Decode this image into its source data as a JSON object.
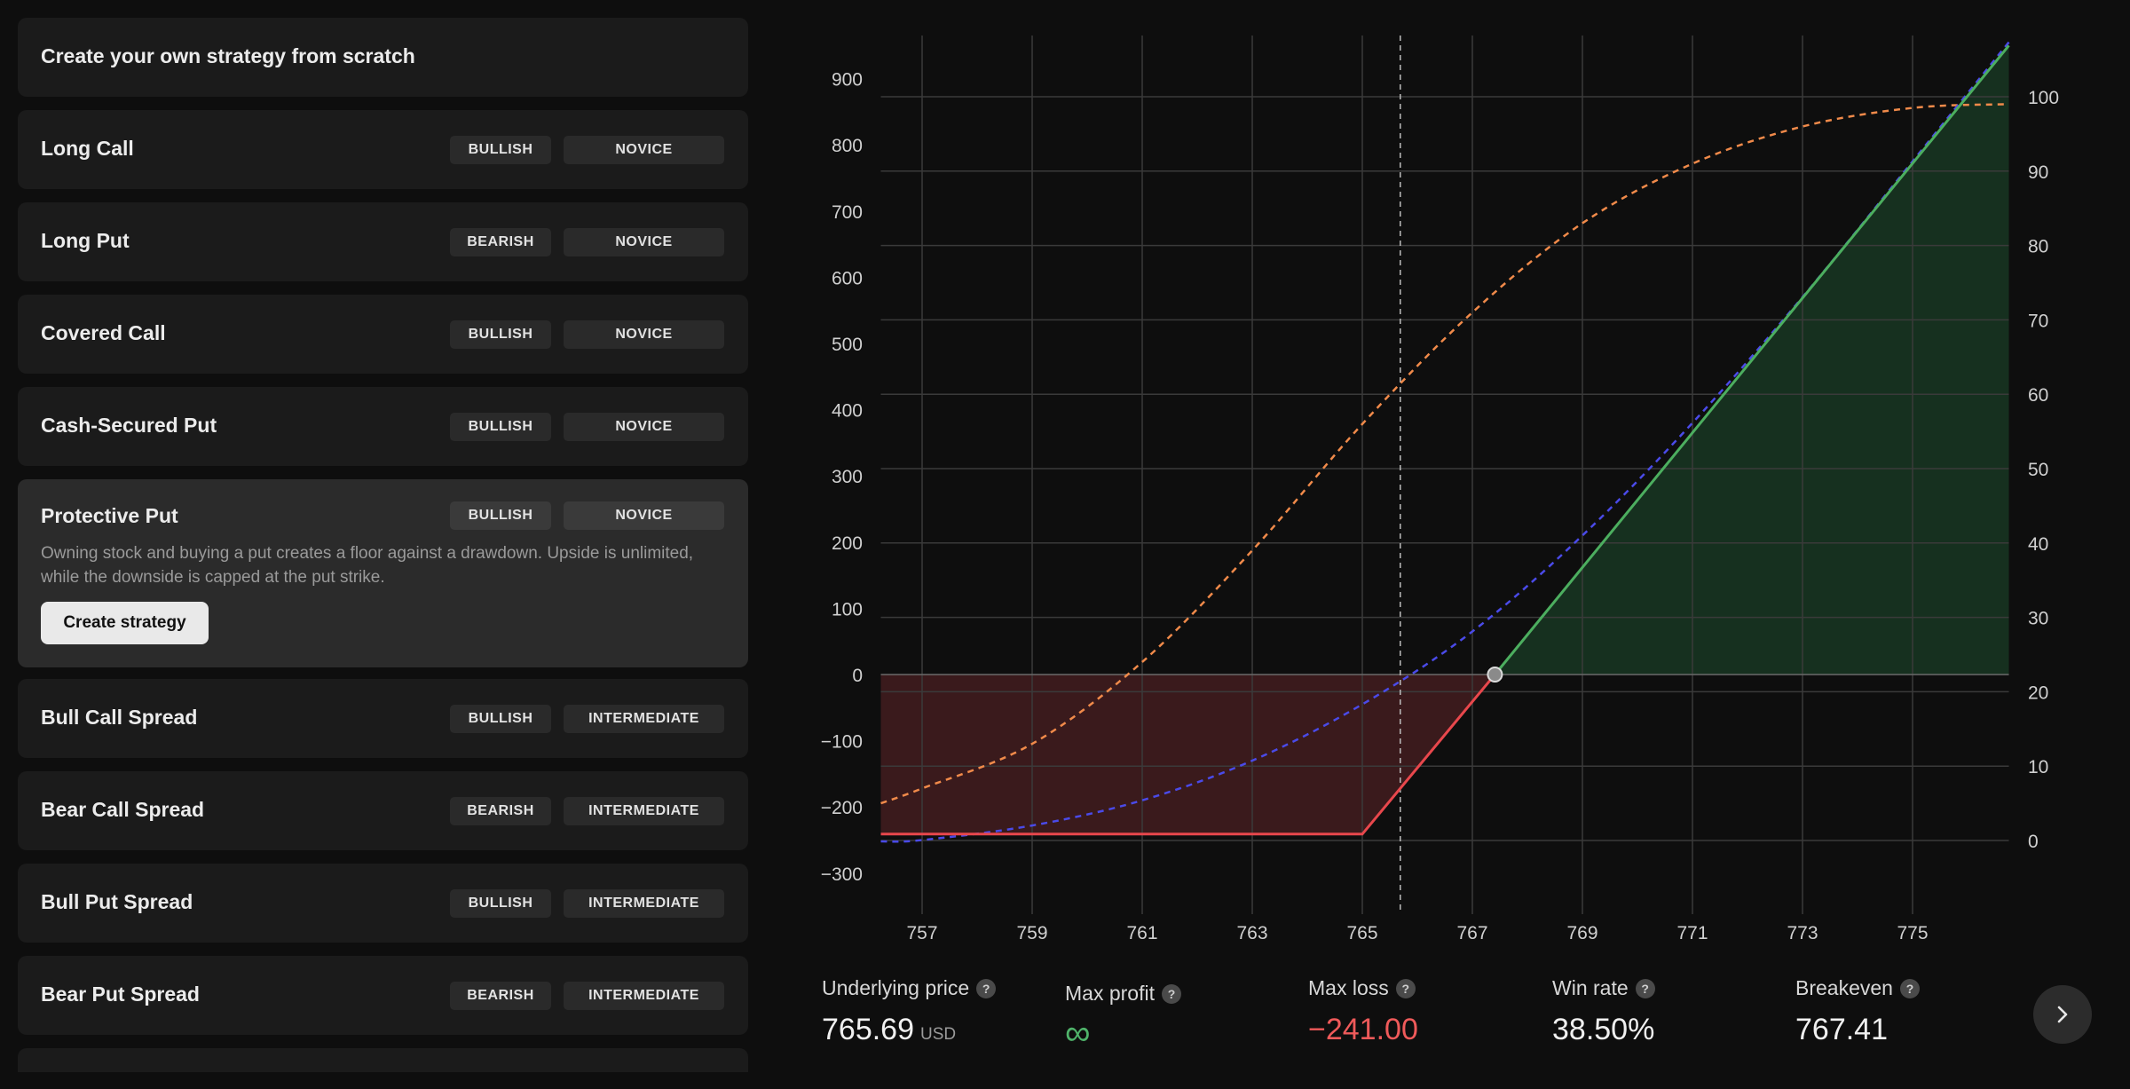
{
  "strategies": {
    "header": "Create your own strategy from scratch",
    "items": [
      {
        "name": "Long Call",
        "sentiment": "BULLISH",
        "level": "NOVICE"
      },
      {
        "name": "Long Put",
        "sentiment": "BEARISH",
        "level": "NOVICE"
      },
      {
        "name": "Covered Call",
        "sentiment": "BULLISH",
        "level": "NOVICE"
      },
      {
        "name": "Cash-Secured Put",
        "sentiment": "BULLISH",
        "level": "NOVICE"
      },
      {
        "name": "Protective Put",
        "sentiment": "BULLISH",
        "level": "NOVICE",
        "description": "Owning stock and buying a put creates a floor against a drawdown. Upside is unlimited, while the downside is capped at the put strike.",
        "button_label": "Create strategy"
      },
      {
        "name": "Bull Call Spread",
        "sentiment": "BULLISH",
        "level": "INTERMEDIATE"
      },
      {
        "name": "Bear Call Spread",
        "sentiment": "BEARISH",
        "level": "INTERMEDIATE"
      },
      {
        "name": "Bull Put Spread",
        "sentiment": "BULLISH",
        "level": "INTERMEDIATE"
      },
      {
        "name": "Bear Put Spread",
        "sentiment": "BEARISH",
        "level": "INTERMEDIATE"
      }
    ]
  },
  "stats": {
    "underlying_price": {
      "label": "Underlying price",
      "value": "765.69",
      "unit": "USD"
    },
    "max_profit": {
      "label": "Max profit",
      "value": "∞"
    },
    "max_loss": {
      "label": "Max loss",
      "value": "−241.00"
    },
    "win_rate": {
      "label": "Win rate",
      "value": "38.50%"
    },
    "breakeven": {
      "label": "Breakeven",
      "value": "767.41"
    },
    "help_glyph": "?"
  },
  "icons": {
    "next": "chevron-right-icon",
    "help": "question-mark-icon",
    "infinity": "infinity-icon"
  },
  "chart_data": {
    "type": "line",
    "x_ticks": [
      757,
      759,
      761,
      763,
      765,
      767,
      769,
      771,
      773,
      775
    ],
    "xlim": [
      756.25,
      776.75
    ],
    "ylim": [
      -300,
      950
    ],
    "y_ticks": [
      -300,
      -200,
      -100,
      0,
      100,
      200,
      300,
      400,
      500,
      600,
      700,
      800,
      900
    ],
    "y2lim": [
      0,
      100
    ],
    "y2_ticks": [
      0,
      10,
      20,
      30,
      40,
      50,
      60,
      70,
      80,
      90,
      100
    ],
    "current_price": 765.69,
    "breakeven": 767.41,
    "grid": true,
    "series": [
      {
        "kind": "payoff",
        "color_loss": "#e8474c",
        "color_profit": "#4cae5f",
        "x": [
          756.25,
          765,
          767.41,
          776.75
        ],
        "y": [
          -241,
          -241,
          0,
          950
        ]
      },
      {
        "kind": "probability",
        "axis": "right",
        "color": "#f08a4a",
        "x": [
          756.25,
          757,
          759,
          761,
          763,
          765,
          767,
          769,
          771,
          773,
          775,
          776.75
        ],
        "y": [
          5,
          7,
          13,
          24,
          39,
          56,
          71,
          83,
          91,
          96,
          98.5,
          99
        ]
      },
      {
        "kind": "theoretical",
        "color": "#4a4ae8",
        "x": [
          756.25,
          757,
          759,
          761,
          763,
          765,
          767,
          769,
          771,
          773,
          775,
          776.75
        ],
        "y": [
          -252,
          -250,
          -228,
          -190,
          -130,
          -45,
          65,
          210,
          380,
          570,
          775,
          955
        ]
      }
    ],
    "colors": {
      "loss_fill": "#3a1a1c",
      "profit_fill": "#16301f",
      "grid": "#3a3a3a",
      "axis_text": "#d0d0d0"
    }
  }
}
